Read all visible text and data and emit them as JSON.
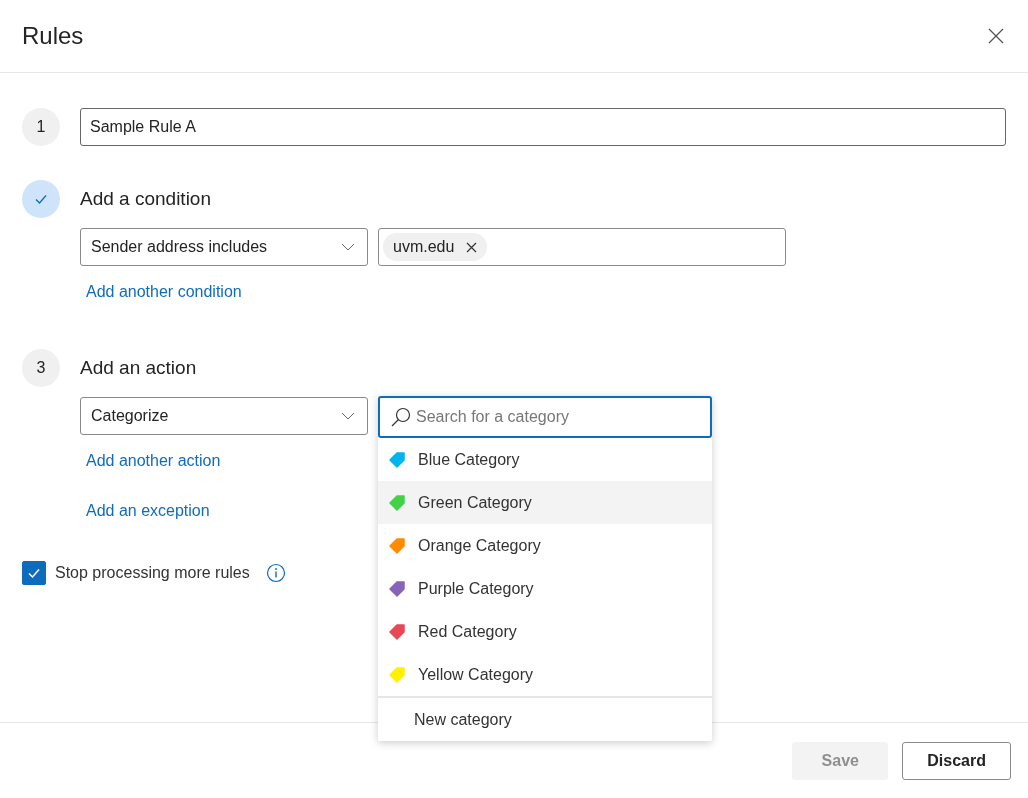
{
  "dialog": {
    "title": "Rules"
  },
  "steps": [
    {
      "kind": "name",
      "marker": "1",
      "completed": false,
      "value": "Sample Rule A"
    },
    {
      "kind": "condition",
      "completed": true,
      "title": "Add a condition",
      "select": "Sender address includes",
      "tags": [
        "uvm.edu"
      ],
      "links": [
        "Add another condition"
      ]
    },
    {
      "kind": "action",
      "marker": "3",
      "completed": false,
      "title": "Add an action",
      "select": "Categorize",
      "links": [
        "Add another action",
        "Add an exception"
      ]
    }
  ],
  "category_menu": {
    "search": {
      "placeholder": "Search for a category"
    },
    "categories": [
      {
        "label": "Blue Category",
        "color": "#00b4ef",
        "selected": false
      },
      {
        "label": "Green Category",
        "color": "#44d14a",
        "selected": true
      },
      {
        "label": "Orange Category",
        "color": "#ff8c00",
        "selected": false
      },
      {
        "label": "Purple Category",
        "color": "#8764b8",
        "selected": false
      },
      {
        "label": "Red Category",
        "color": "#e74856",
        "selected": false
      },
      {
        "label": "Yellow Category",
        "color": "#fff100",
        "selected": false
      }
    ],
    "new_category": "New category"
  },
  "stop_processing": {
    "label": "Stop processing more rules",
    "checked": true
  },
  "buttons": [
    {
      "label": "Save",
      "disabled": true
    },
    {
      "label": "Discard",
      "disabled": false
    }
  ]
}
